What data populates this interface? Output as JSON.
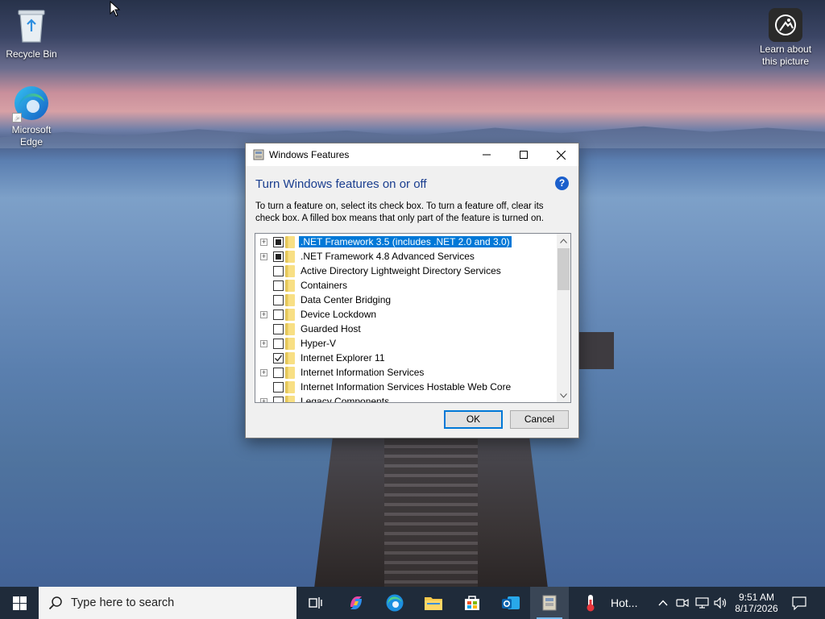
{
  "desktop": {
    "icons": [
      {
        "label": "Recycle Bin"
      },
      {
        "label": "Microsoft Edge"
      },
      {
        "label": "Learn about this picture"
      }
    ]
  },
  "dialog": {
    "title": "Windows Features",
    "heading": "Turn Windows features on or off",
    "description": "To turn a feature on, select its check box. To turn a feature off, clear its check box. A filled box means that only part of the feature is turned on.",
    "features": [
      {
        "label": ".NET Framework 3.5 (includes .NET 2.0 and 3.0)",
        "state": "partial",
        "expandable": true,
        "selected": true
      },
      {
        "label": ".NET Framework 4.8 Advanced Services",
        "state": "partial",
        "expandable": true,
        "selected": false
      },
      {
        "label": "Active Directory Lightweight Directory Services",
        "state": "unchecked",
        "expandable": false,
        "selected": false
      },
      {
        "label": "Containers",
        "state": "unchecked",
        "expandable": false,
        "selected": false
      },
      {
        "label": "Data Center Bridging",
        "state": "unchecked",
        "expandable": false,
        "selected": false
      },
      {
        "label": "Device Lockdown",
        "state": "unchecked",
        "expandable": true,
        "selected": false
      },
      {
        "label": "Guarded Host",
        "state": "unchecked",
        "expandable": false,
        "selected": false
      },
      {
        "label": "Hyper-V",
        "state": "unchecked",
        "expandable": true,
        "selected": false
      },
      {
        "label": "Internet Explorer 11",
        "state": "checked",
        "expandable": false,
        "selected": false
      },
      {
        "label": "Internet Information Services",
        "state": "unchecked",
        "expandable": true,
        "selected": false
      },
      {
        "label": "Internet Information Services Hostable Web Core",
        "state": "unchecked",
        "expandable": false,
        "selected": false
      },
      {
        "label": "Legacy Components",
        "state": "unchecked",
        "expandable": true,
        "selected": false
      }
    ],
    "ok_label": "OK",
    "cancel_label": "Cancel",
    "help_glyph": "?"
  },
  "taskbar": {
    "search_placeholder": "Type here to search",
    "weather_label": "Hot...",
    "time": "9:51 AM",
    "date": "8/17/2026"
  },
  "colors": {
    "accent": "#0078d7",
    "heading": "#1a3e8f",
    "taskbar": "#1f2b3a"
  }
}
